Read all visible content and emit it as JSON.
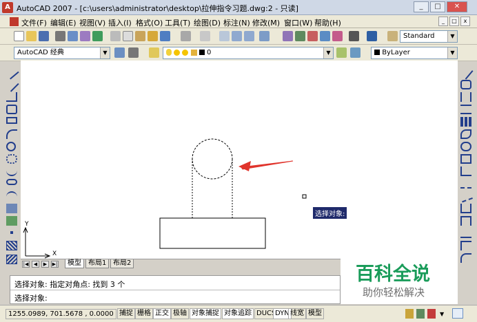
{
  "window": {
    "app_icon_text": "A",
    "title": "AutoCAD 2007 - [c:\\users\\administrator\\desktop\\拉伸指令习题.dwg:2 - 只读]",
    "minimize": "_",
    "restore": "□",
    "close": "✕"
  },
  "menu": {
    "items": [
      "文件(F)",
      "编辑(E)",
      "视图(V)",
      "插入(I)",
      "格式(O)",
      "工具(T)",
      "绘图(D)",
      "标注(N)",
      "修改(M)",
      "窗口(W)",
      "帮助(H)"
    ],
    "doc_minimize": "_",
    "doc_restore": "□",
    "doc_close": "x"
  },
  "toolbar": {
    "text_style": "Standard",
    "workspace": "AutoCAD 经典",
    "layer": "0",
    "color": "ByLayer",
    "dropdown_arrow": "▼"
  },
  "drawing": {
    "ucs_y": "Y",
    "ucs_x": "X",
    "pick_box": ""
  },
  "tooltip": "选择对象:",
  "tabs": {
    "nav": [
      "|◀",
      "◀",
      "▶",
      "▶|"
    ],
    "items": [
      "模型",
      "布局1",
      "布局2"
    ]
  },
  "command": {
    "line1": "选择对象: 指定对角点: 找到 3 个",
    "line2": "选择对象:"
  },
  "status": {
    "coords": "1255.0989, 701.5678 , 0.0000",
    "buttons": [
      "捕捉",
      "栅格",
      "正交",
      "极轴",
      "对象捕捉",
      "对象追踪",
      "DUCS",
      "DYN",
      "线宽",
      "模型"
    ]
  },
  "watermark": {
    "title": "百科全说",
    "subtitle": "助你轻松解决"
  },
  "colors": {
    "arrow": "#e0342c",
    "watermark": "#1a9c5a",
    "tooltip_bg": "#1f2a6b"
  }
}
